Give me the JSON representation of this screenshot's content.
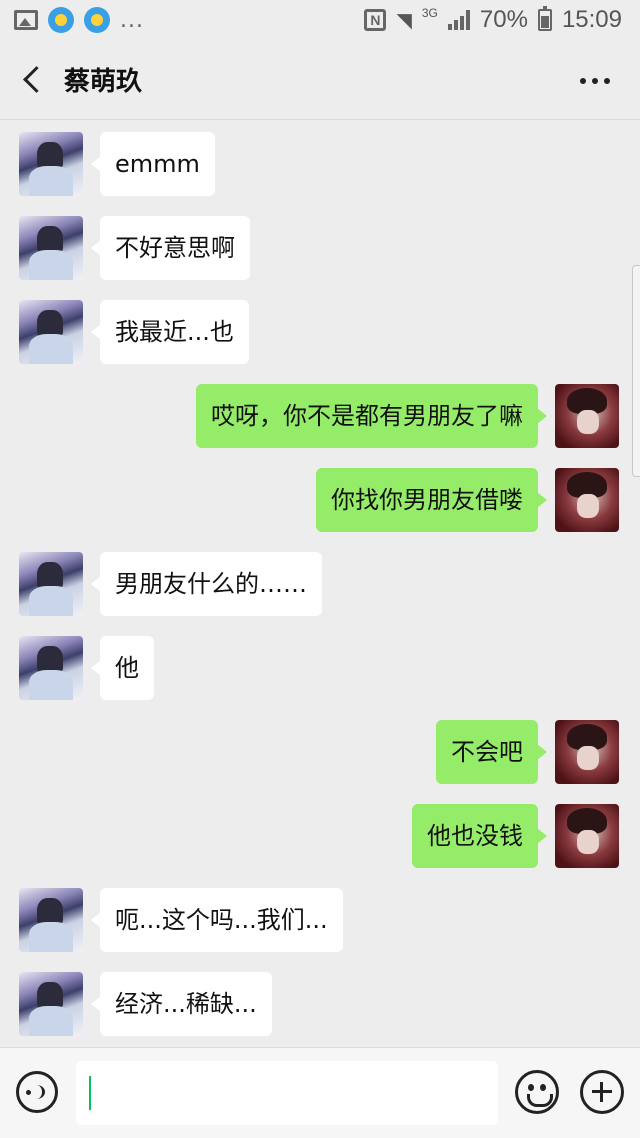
{
  "status_bar": {
    "more_notifications": "...",
    "network": "3G",
    "battery_percent": "70%",
    "time": "15:09",
    "icons": [
      "gallery-icon",
      "weather-icon",
      "weather-icon",
      "nfc-icon",
      "wifi-icon",
      "signal-icon",
      "battery-icon"
    ]
  },
  "header": {
    "title": "蔡萌玖",
    "icons": [
      "back-icon",
      "more-icon"
    ]
  },
  "messages": [
    {
      "side": "left",
      "text": "emmm"
    },
    {
      "side": "left",
      "text": "不好意思啊"
    },
    {
      "side": "left",
      "text": "我最近...也"
    },
    {
      "side": "right",
      "text": "哎呀，你不是都有男朋友了嘛"
    },
    {
      "side": "right",
      "text": "你找你男朋友借喽"
    },
    {
      "side": "left",
      "text": "男朋友什么的……"
    },
    {
      "side": "left",
      "text": "他"
    },
    {
      "side": "right",
      "text": "不会吧"
    },
    {
      "side": "right",
      "text": "他也没钱"
    },
    {
      "side": "left",
      "text": "呃...这个吗...我们..."
    },
    {
      "side": "left",
      "text": "经济...稀缺..."
    }
  ],
  "input_bar": {
    "value": "",
    "icons": [
      "voice-icon",
      "emoji-icon",
      "plus-icon"
    ]
  },
  "colors": {
    "background": "#ededed",
    "sent_bubble": "#95ec69",
    "received_bubble": "#ffffff",
    "cursor": "#07c160"
  }
}
